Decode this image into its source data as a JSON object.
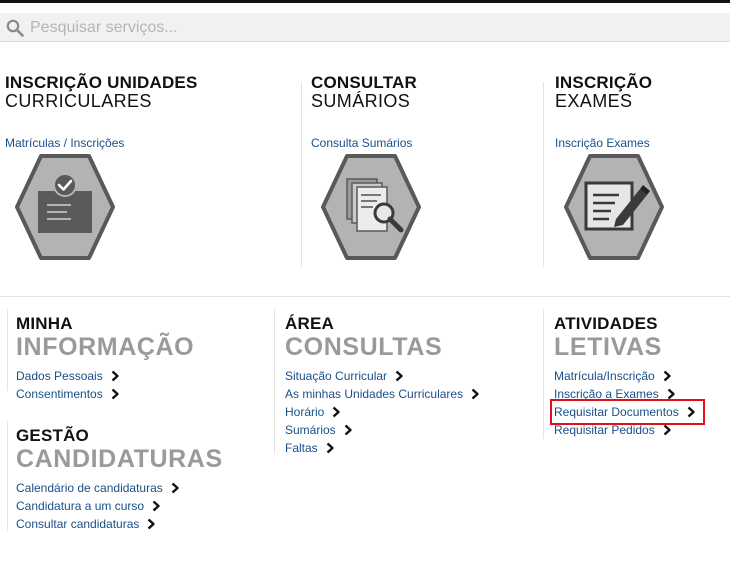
{
  "search": {
    "placeholder": "Pesquisar serviços..."
  },
  "tiles": [
    {
      "title_line1": "INSCRIÇÃO UNIDADES",
      "title_line2": "CURRICULARES",
      "link": "Matrículas / Inscrições",
      "icon": "checkmark-document-icon"
    },
    {
      "title_line1": "CONSULTAR",
      "title_line2": "SUMÁRIOS",
      "link": "Consulta Sumários",
      "icon": "magnifier-documents-icon"
    },
    {
      "title_line1": "INSCRIÇÃO",
      "title_line2": "EXAMES",
      "link": "Inscrição Exames",
      "icon": "pen-form-icon"
    }
  ],
  "sections": {
    "minha_informacao": {
      "title_line1": "MINHA",
      "title_line2": "INFORMAÇÃO",
      "links": [
        "Dados Pessoais",
        "Consentimentos"
      ]
    },
    "gestao_candidaturas": {
      "title_line1": "GESTÃO",
      "title_line2": "CANDIDATURAS",
      "links": [
        "Calendário de candidaturas",
        "Candidatura a um curso",
        "Consultar candidaturas"
      ]
    },
    "area_consultas": {
      "title_line1": "ÁREA",
      "title_line2": "CONSULTAS",
      "links": [
        "Situação Curricular",
        "As minhas Unidades Curriculares",
        "Horário",
        "Sumários",
        "Faltas"
      ]
    },
    "atividades_letivas": {
      "title_line1": "ATIVIDADES",
      "title_line2": "LETIVAS",
      "links": [
        "Matrícula/Inscrição",
        "Inscrição a Exames",
        "Requisitar Documentos",
        "Requisitar Pedidos"
      ]
    }
  },
  "colors": {
    "link": "#1a4f8a",
    "muted_heading": "#9a9a9a",
    "highlight": "#e0101a",
    "hex_fill": "#b3b3b3",
    "hex_border": "#595959"
  }
}
